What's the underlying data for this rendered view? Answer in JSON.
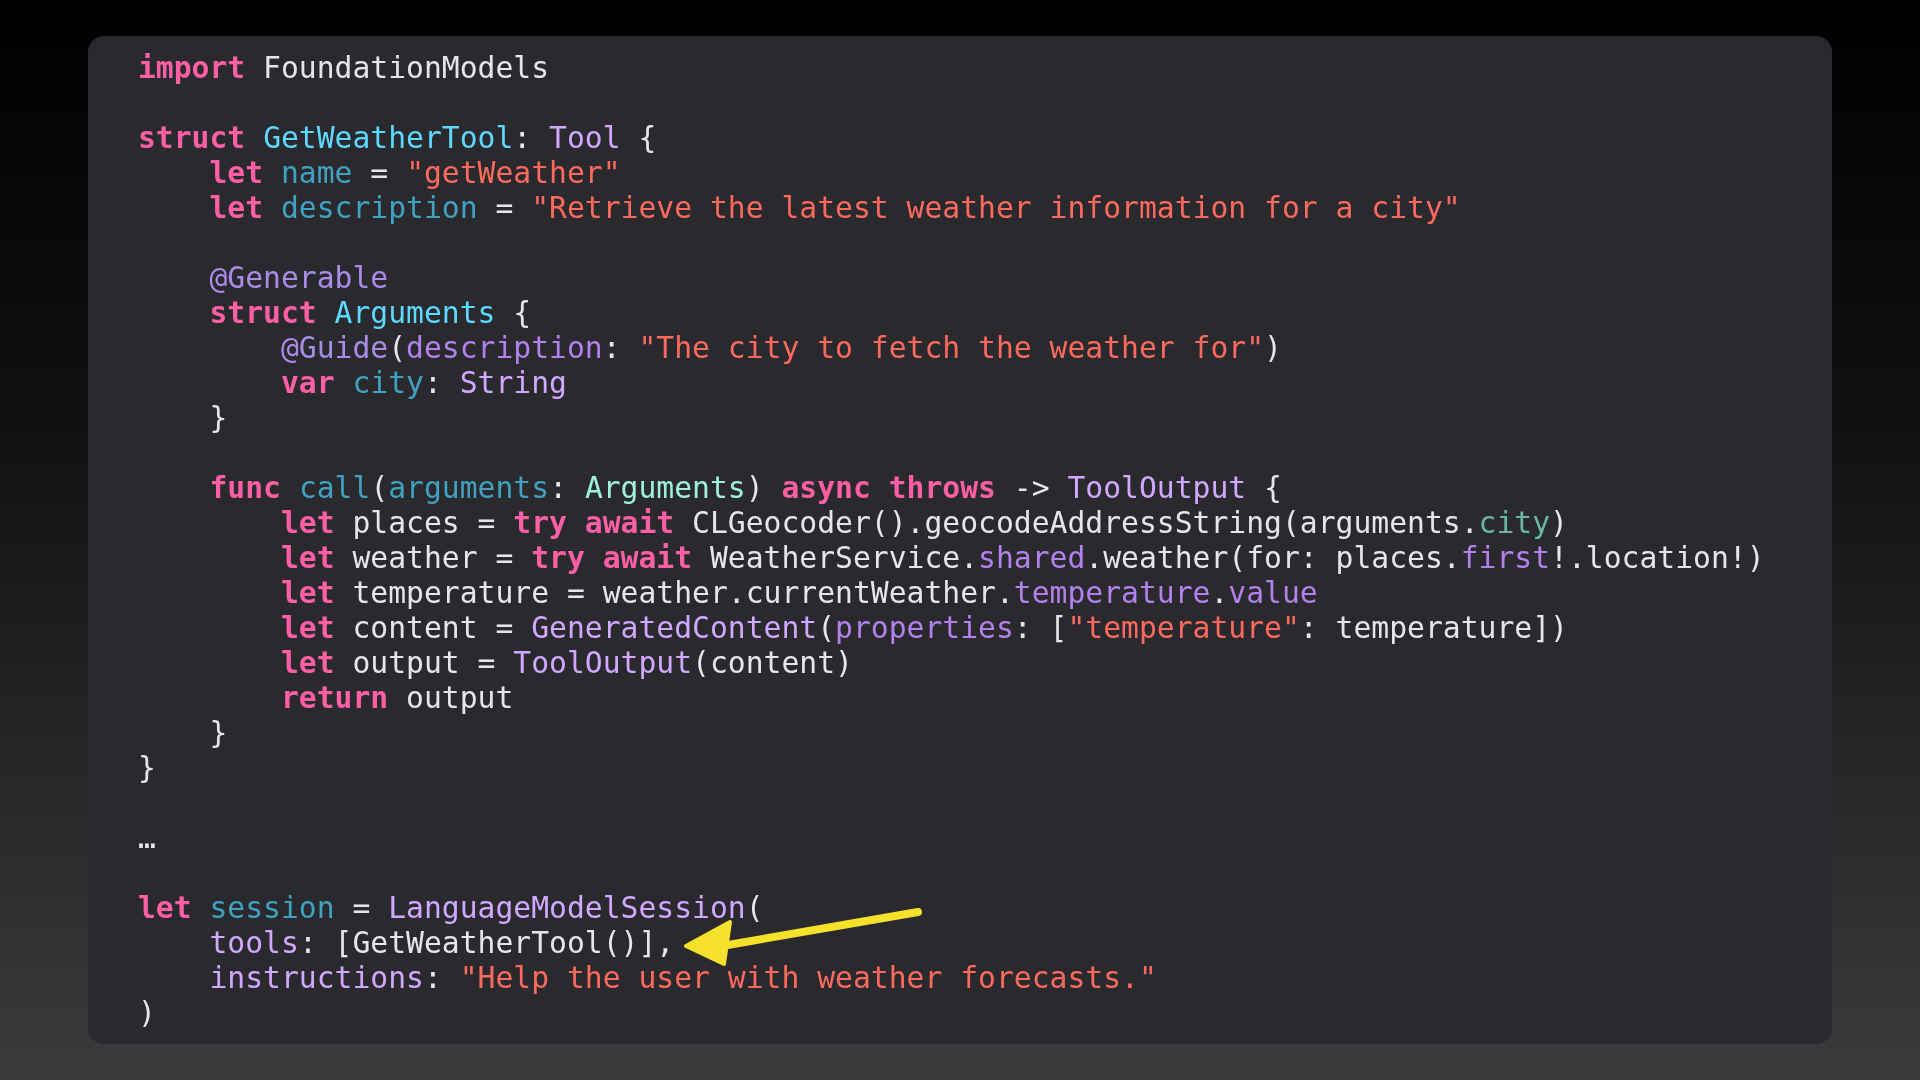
{
  "code_lines": [
    {
      "kind": "code",
      "tokens": [
        {
          "kind": "kw",
          "text": "import"
        },
        {
          "kind": "plain",
          "text": " FoundationModels"
        }
      ]
    },
    {
      "kind": "blank"
    },
    {
      "kind": "code",
      "tokens": [
        {
          "kind": "kw",
          "text": "struct "
        },
        {
          "kind": "decl",
          "text": "GetWeatherTool"
        },
        {
          "kind": "plain",
          "text": ": "
        },
        {
          "kind": "type",
          "text": "Tool"
        },
        {
          "kind": "plain",
          "text": " {"
        }
      ]
    },
    {
      "kind": "code",
      "tokens": [
        {
          "kind": "kw",
          "text": "    let "
        },
        {
          "kind": "id",
          "text": "name"
        },
        {
          "kind": "plain",
          "text": " = "
        },
        {
          "kind": "str",
          "text": "\"getWeather\""
        }
      ]
    },
    {
      "kind": "code",
      "tokens": [
        {
          "kind": "kw",
          "text": "    let "
        },
        {
          "kind": "id",
          "text": "description"
        },
        {
          "kind": "plain",
          "text": " = "
        },
        {
          "kind": "str",
          "text": "\"Retrieve the latest weather information for a city\""
        }
      ]
    },
    {
      "kind": "blank"
    },
    {
      "kind": "code",
      "tokens": [
        {
          "kind": "attr",
          "text": "    @Generable"
        }
      ]
    },
    {
      "kind": "code",
      "tokens": [
        {
          "kind": "kw",
          "text": "    struct "
        },
        {
          "kind": "decl",
          "text": "Arguments"
        },
        {
          "kind": "plain",
          "text": " {"
        }
      ]
    },
    {
      "kind": "code",
      "tokens": [
        {
          "kind": "attr",
          "text": "        @Guide"
        },
        {
          "kind": "plain",
          "text": "("
        },
        {
          "kind": "member",
          "text": "description"
        },
        {
          "kind": "plain",
          "text": ": "
        },
        {
          "kind": "str",
          "text": "\"The city to fetch the weather for\""
        },
        {
          "kind": "plain",
          "text": ")"
        }
      ]
    },
    {
      "kind": "code",
      "tokens": [
        {
          "kind": "kw",
          "text": "        var "
        },
        {
          "kind": "id",
          "text": "city"
        },
        {
          "kind": "plain",
          "text": ": "
        },
        {
          "kind": "type",
          "text": "String"
        }
      ]
    },
    {
      "kind": "code",
      "tokens": [
        {
          "kind": "plain",
          "text": "    }"
        }
      ]
    },
    {
      "kind": "blank"
    },
    {
      "kind": "code",
      "tokens": [
        {
          "kind": "kw",
          "text": "    func "
        },
        {
          "kind": "id",
          "text": "call"
        },
        {
          "kind": "plain",
          "text": "("
        },
        {
          "kind": "id",
          "text": "arguments"
        },
        {
          "kind": "plain",
          "text": ": "
        },
        {
          "kind": "local",
          "text": "Arguments"
        },
        {
          "kind": "plain",
          "text": ") "
        },
        {
          "kind": "kw",
          "text": "async throws"
        },
        {
          "kind": "plain",
          "text": " -> "
        },
        {
          "kind": "type",
          "text": "ToolOutput"
        },
        {
          "kind": "plain",
          "text": " {"
        }
      ]
    },
    {
      "kind": "code",
      "tokens": [
        {
          "kind": "kw",
          "text": "        let"
        },
        {
          "kind": "plain",
          "text": " places = "
        },
        {
          "kind": "kw",
          "text": "try await"
        },
        {
          "kind": "plain",
          "text": " CLGeocoder().geocodeAddressString(arguments."
        },
        {
          "kind": "localmember",
          "text": "city"
        },
        {
          "kind": "plain",
          "text": ")"
        }
      ]
    },
    {
      "kind": "code",
      "tokens": [
        {
          "kind": "kw",
          "text": "        let"
        },
        {
          "kind": "plain",
          "text": " weather = "
        },
        {
          "kind": "kw",
          "text": "try await"
        },
        {
          "kind": "plain",
          "text": " WeatherService."
        },
        {
          "kind": "member",
          "text": "shared"
        },
        {
          "kind": "plain",
          "text": ".weather(for: places."
        },
        {
          "kind": "member",
          "text": "first"
        },
        {
          "kind": "plain",
          "text": "!.location!)"
        }
      ]
    },
    {
      "kind": "code",
      "tokens": [
        {
          "kind": "kw",
          "text": "        let"
        },
        {
          "kind": "plain",
          "text": " temperature = weather.currentWeather."
        },
        {
          "kind": "member",
          "text": "temperature"
        },
        {
          "kind": "plain",
          "text": "."
        },
        {
          "kind": "member",
          "text": "value"
        }
      ]
    },
    {
      "kind": "code",
      "tokens": [
        {
          "kind": "kw",
          "text": "        let"
        },
        {
          "kind": "plain",
          "text": " content = "
        },
        {
          "kind": "type",
          "text": "GeneratedContent"
        },
        {
          "kind": "plain",
          "text": "("
        },
        {
          "kind": "member",
          "text": "properties"
        },
        {
          "kind": "plain",
          "text": ": ["
        },
        {
          "kind": "str",
          "text": "\"temperature\""
        },
        {
          "kind": "plain",
          "text": ": temperature])"
        }
      ]
    },
    {
      "kind": "code",
      "tokens": [
        {
          "kind": "kw",
          "text": "        let"
        },
        {
          "kind": "plain",
          "text": " output = "
        },
        {
          "kind": "type",
          "text": "ToolOutput"
        },
        {
          "kind": "plain",
          "text": "(content)"
        }
      ]
    },
    {
      "kind": "code",
      "tokens": [
        {
          "kind": "kw",
          "text": "        return"
        },
        {
          "kind": "plain",
          "text": " output"
        }
      ]
    },
    {
      "kind": "code",
      "tokens": [
        {
          "kind": "plain",
          "text": "    }"
        }
      ]
    },
    {
      "kind": "code",
      "tokens": [
        {
          "kind": "plain",
          "text": "}"
        }
      ]
    },
    {
      "kind": "blank"
    },
    {
      "kind": "code",
      "tokens": [
        {
          "kind": "plain",
          "text": "…"
        }
      ]
    },
    {
      "kind": "blank"
    },
    {
      "kind": "code",
      "tokens": [
        {
          "kind": "kw",
          "text": "let "
        },
        {
          "kind": "id",
          "text": "session"
        },
        {
          "kind": "plain",
          "text": " = "
        },
        {
          "kind": "type",
          "text": "LanguageModelSession"
        },
        {
          "kind": "plain",
          "text": "("
        }
      ]
    },
    {
      "kind": "code",
      "tokens": [
        {
          "kind": "type",
          "text": "    tools"
        },
        {
          "kind": "plain",
          "text": ": [GetWeatherTool()],"
        }
      ]
    },
    {
      "kind": "code",
      "tokens": [
        {
          "kind": "type",
          "text": "    instructions"
        },
        {
          "kind": "plain",
          "text": ": "
        },
        {
          "kind": "str",
          "text": "\"Help the user with weather forecasts.\""
        }
      ]
    },
    {
      "kind": "code",
      "tokens": [
        {
          "kind": "plain",
          "text": ")"
        }
      ]
    }
  ]
}
